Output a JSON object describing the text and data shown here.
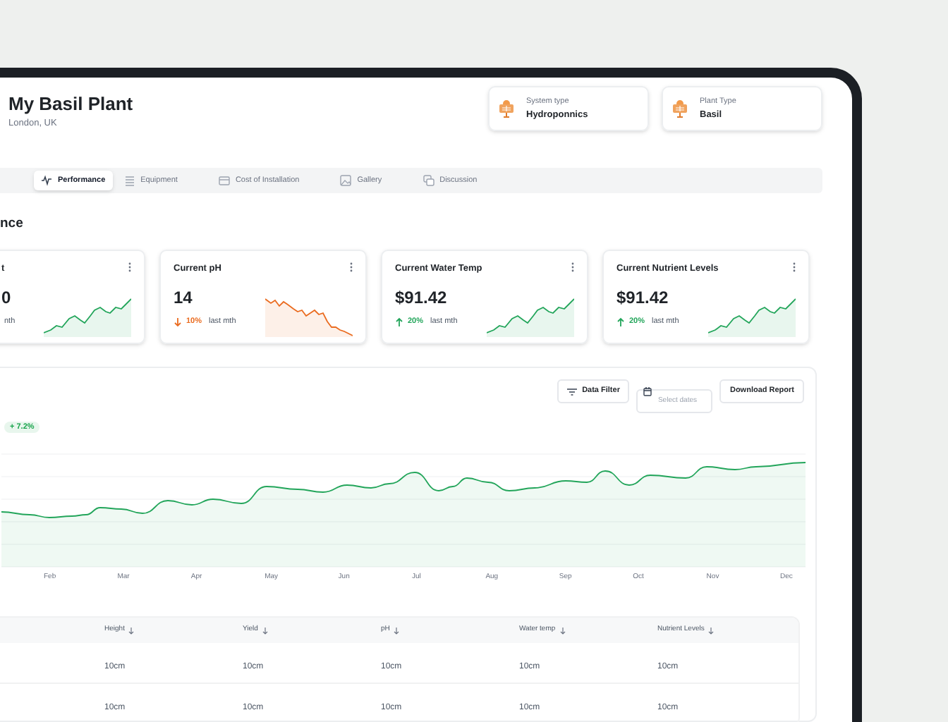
{
  "header": {
    "title": "My Basil Plant",
    "location": "London, UK"
  },
  "info_cards": [
    {
      "label": "System type",
      "value": "Hydroponnics"
    },
    {
      "label": "Plant Type",
      "value": "Basil"
    }
  ],
  "tabs": [
    {
      "label": "Performance",
      "selected": true,
      "kind": "pulse"
    },
    {
      "label": "Equipment",
      "selected": false,
      "kind": "list"
    },
    {
      "label": "Cost of Installation",
      "selected": false,
      "kind": "card"
    },
    {
      "label": "Gallery",
      "selected": false,
      "kind": "image"
    },
    {
      "label": "Discussion",
      "selected": false,
      "kind": "chat"
    }
  ],
  "section_title": "nce",
  "stat_cards": [
    {
      "title": "t",
      "value": "0",
      "period": "nth",
      "kind": "up"
    },
    {
      "title": "Current pH",
      "value": "14",
      "change": "10%",
      "period": "last mth",
      "kind": "down"
    },
    {
      "title": "Current Water Temp",
      "value": "$91.42",
      "change": "20%",
      "period": "last mth",
      "kind": "up"
    },
    {
      "title": "Current Nutrient Levels",
      "value": "$91.42",
      "change": "20%",
      "period": "last mth",
      "kind": "up"
    }
  ],
  "chart_panel": {
    "badge": "+ 7.2%",
    "filter_button": "Data Filter",
    "date_field": {
      "placeholder": "Select dates"
    },
    "download_button": "Download Report",
    "months": [
      "Feb",
      "Mar",
      "Apr",
      "May",
      "Jun",
      "Jul",
      "Aug",
      "Sep",
      "Oct",
      "Nov",
      "Dec"
    ]
  },
  "table": {
    "columns": [
      "Height",
      "Yield",
      "pH",
      "Water temp",
      "Nutrient Levels"
    ],
    "rows": [
      [
        "10cm",
        "10cm",
        "10cm",
        "10cm",
        "10cm"
      ],
      [
        "10cm",
        "10cm",
        "10cm",
        "10cm",
        "10cm"
      ]
    ]
  }
}
